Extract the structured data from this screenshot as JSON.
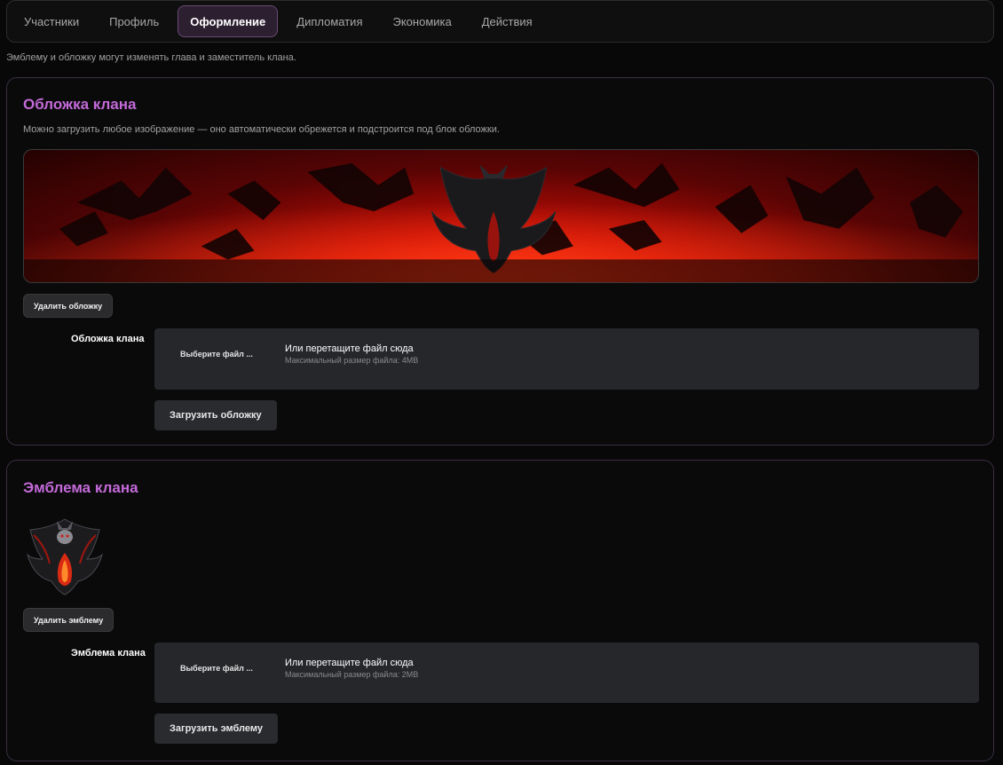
{
  "tabs": [
    {
      "label": "Участники",
      "active": false
    },
    {
      "label": "Профиль",
      "active": false
    },
    {
      "label": "Оформление",
      "active": true
    },
    {
      "label": "Дипломатия",
      "active": false
    },
    {
      "label": "Экономика",
      "active": false
    },
    {
      "label": "Действия",
      "active": false
    }
  ],
  "notice": "Эмблему и обложку могут изменять глава и заместитель клана.",
  "cover": {
    "title": "Обложка клана",
    "description": "Можно загрузить любое изображение — оно автоматически обрежется и подстроится под блок обложки.",
    "delete_label": "Удалить обложку",
    "field_label": "Обложка клана",
    "choose_label": "Выберите файл ...",
    "drop_label": "Или перетащите файл сюда",
    "max_size": "Максимальный размер файла: 4MB",
    "upload_label": "Загрузить обложку"
  },
  "emblem": {
    "title": "Эмблема клана",
    "delete_label": "Удалить эмблему",
    "field_label": "Эмблема клана",
    "choose_label": "Выберите файл ...",
    "drop_label": "Или перетащите файл сюда",
    "max_size": "Максимальный размер файла: 2MB",
    "upload_label": "Загрузить эмблему"
  },
  "colors": {
    "accent": "#c46ad9",
    "active_tab_bg": "#2c1f30",
    "panel_border": "#3a2d40",
    "cover_red": "#c30d05"
  },
  "icons": {
    "cover_image": "demon-ravens-banner",
    "emblem_image": "winged-demon-emblem"
  }
}
